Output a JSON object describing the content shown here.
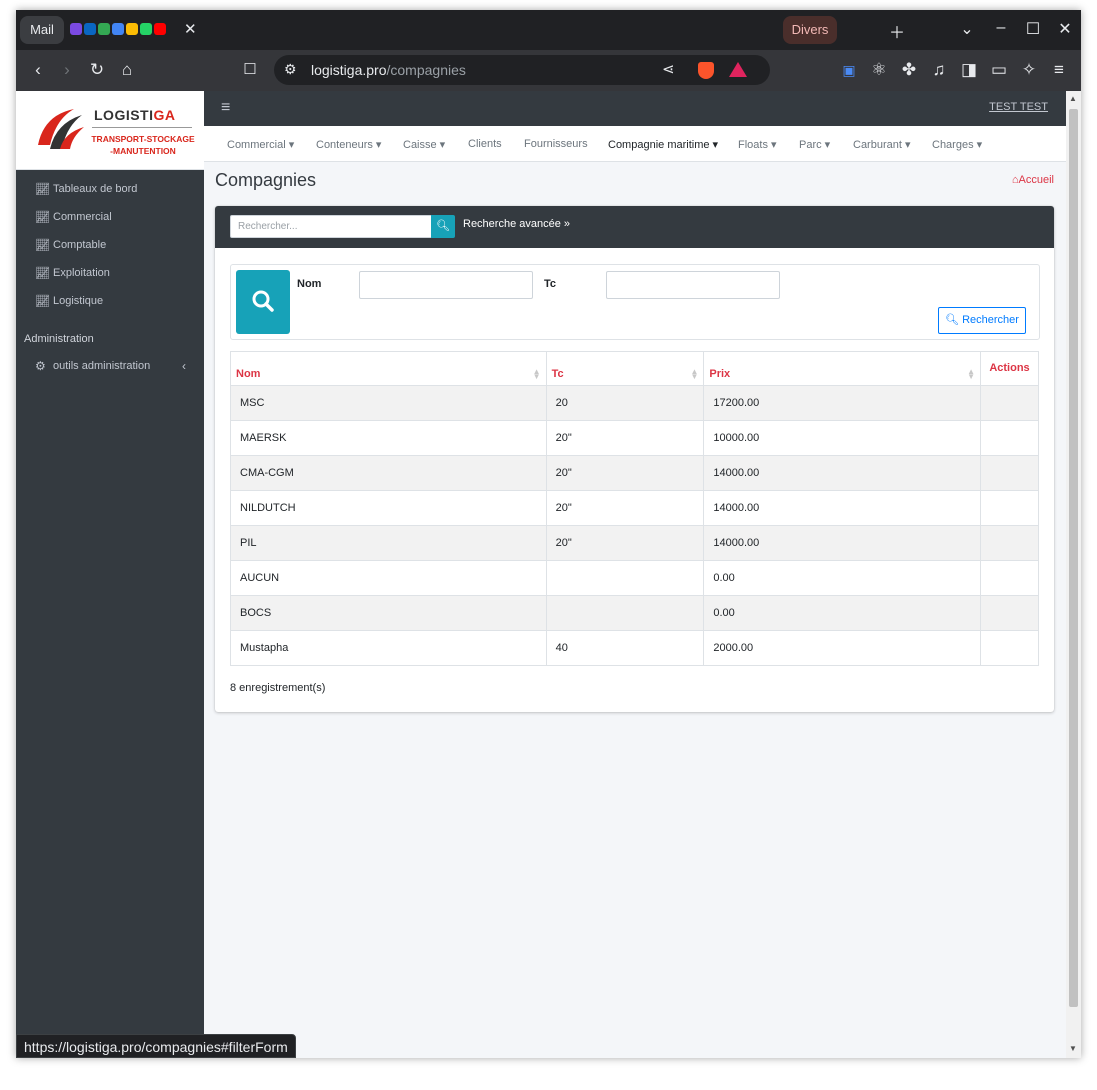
{
  "browser": {
    "tab_mail": "Mail",
    "tab_group": "Divers",
    "url_host": "logistiga.pro",
    "url_path": "/compagnies",
    "status_url": "https://logistiga.pro/compagnies#filterForm"
  },
  "brand": {
    "name_main": "LOGISTI",
    "name_accent": "GA",
    "subtitle_line1": "TRANSPORT-STOCKAGE",
    "subtitle_line2": "-MANUTENTION"
  },
  "sidebar": {
    "items": [
      {
        "label": "Tableaux de bord",
        "icon": "chart-line-icon"
      },
      {
        "label": "Commercial",
        "icon": "chart-line-icon"
      },
      {
        "label": "Comptable",
        "icon": "chart-line-icon"
      },
      {
        "label": "Exploitation",
        "icon": "chart-line-icon"
      },
      {
        "label": "Logistique",
        "icon": "chart-line-icon"
      }
    ],
    "section_header": "Administration",
    "admin_item": {
      "label": "outils administration",
      "icon": "cogs-icon"
    }
  },
  "topbar": {
    "user": "TEST TEST"
  },
  "menu": {
    "items": [
      {
        "label": "Commercial ▾"
      },
      {
        "label": "Conteneurs ▾"
      },
      {
        "label": "Caisse ▾"
      },
      {
        "label": "Clients"
      },
      {
        "label": "Fournisseurs"
      },
      {
        "label": "Compagnie maritime ▾"
      },
      {
        "label": "Floats ▾"
      },
      {
        "label": "Parc ▾"
      },
      {
        "label": "Carburant ▾"
      },
      {
        "label": "Charges ▾"
      }
    ],
    "active_index": 5
  },
  "page": {
    "title": "Compagnies",
    "breadcrumb": "Accueil"
  },
  "search": {
    "placeholder": "Rechercher...",
    "advanced": "Recherche avancée »"
  },
  "filter": {
    "nom_label": "Nom",
    "nom_value": "",
    "tc_label": "Tc",
    "tc_value": "",
    "submit": "Rechercher"
  },
  "table": {
    "headers": {
      "nom": "Nom",
      "tc": "Tc",
      "prix": "Prix",
      "actions": "Actions"
    },
    "rows": [
      {
        "nom": "MSC",
        "tc": "20",
        "prix": "17200.00"
      },
      {
        "nom": "MAERSK",
        "tc": "20\"",
        "prix": "10000.00"
      },
      {
        "nom": "CMA-CGM",
        "tc": "20\"",
        "prix": "14000.00"
      },
      {
        "nom": "NILDUTCH",
        "tc": "20\"",
        "prix": "14000.00"
      },
      {
        "nom": "PIL",
        "tc": "20\"",
        "prix": "14000.00"
      },
      {
        "nom": "AUCUN",
        "tc": "",
        "prix": "0.00"
      },
      {
        "nom": "BOCS",
        "tc": "",
        "prix": "0.00"
      },
      {
        "nom": "Mustapha",
        "tc": "40",
        "prix": "2000.00"
      }
    ],
    "count": "8 enregistrement(s)"
  },
  "colors": {
    "sidebar_bg": "#343a40",
    "accent_info": "#17a2b8",
    "header_text": "#dc3545",
    "primary": "#007bff"
  }
}
